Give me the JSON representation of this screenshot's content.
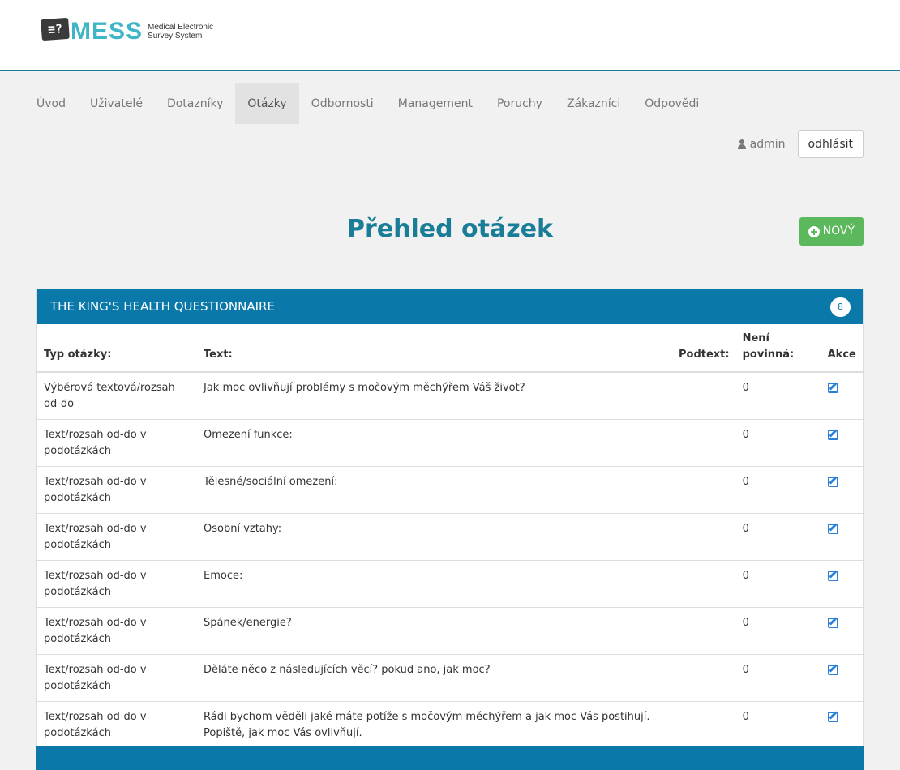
{
  "logo": {
    "mark": "≡?",
    "name": "MESS",
    "subtitle_1": "Medical Electronic",
    "subtitle_2": "Survey System"
  },
  "nav": {
    "items": [
      {
        "label": "Úvod"
      },
      {
        "label": "Uživatelé"
      },
      {
        "label": "Dotazníky"
      },
      {
        "label": "Otázky"
      },
      {
        "label": "Odbornosti"
      },
      {
        "label": "Management"
      },
      {
        "label": "Poruchy"
      },
      {
        "label": "Zákazníci"
      },
      {
        "label": "Odpovědi"
      }
    ],
    "active": "Otázky"
  },
  "user": {
    "name": "admin",
    "logout_label": "odhlásit"
  },
  "page": {
    "title": "Přehled otázek",
    "new_label": "NOVÝ"
  },
  "panel": {
    "title": "THE KING'S HEALTH QUESTIONNAIRE",
    "count": "8",
    "columns": {
      "type": "Typ otázky:",
      "text": "Text:",
      "subtext": "Podtext:",
      "required": "Není povinná:",
      "actions": "Akce"
    },
    "rows": [
      {
        "type": "Výběrová textová/rozsah od-do",
        "text": "Jak moc ovlivňují problémy s močovým měchýřem Váš život?",
        "subtext": "",
        "required": "0"
      },
      {
        "type": "Text/rozsah od-do v podotázkách",
        "text": "Omezení funkce:",
        "subtext": "",
        "required": "0"
      },
      {
        "type": "Text/rozsah od-do v podotázkách",
        "text": "Tělesné/sociální omezení:",
        "subtext": "",
        "required": "0"
      },
      {
        "type": "Text/rozsah od-do v podotázkách",
        "text": "Osobní vztahy:",
        "subtext": "",
        "required": "0"
      },
      {
        "type": "Text/rozsah od-do v podotázkách",
        "text": "Emoce:",
        "subtext": "",
        "required": "0"
      },
      {
        "type": "Text/rozsah od-do v podotázkách",
        "text": "Spánek/energie?",
        "subtext": "",
        "required": "0"
      },
      {
        "type": "Text/rozsah od-do v podotázkách",
        "text": "Děláte něco z následujících věcí? pokud ano, jak moc?",
        "subtext": "",
        "required": "0"
      },
      {
        "type": "Text/rozsah od-do v podotázkách",
        "text": "Rádi bychom věděli jaké máte potíže s močovým měchýřem a jak moc Vás postihují. Popiště, jak moc Vás ovlivňují.",
        "subtext": "",
        "required": "0"
      }
    ]
  },
  "colors": {
    "brand": "#1a7d97",
    "panel_heading": "#0a78a8",
    "new_button": "#5cb85c",
    "edit_icon": "#2a7fd8"
  },
  "icons": {
    "user": "user-icon",
    "new": "plus-circle-icon",
    "edit": "edit-icon"
  }
}
